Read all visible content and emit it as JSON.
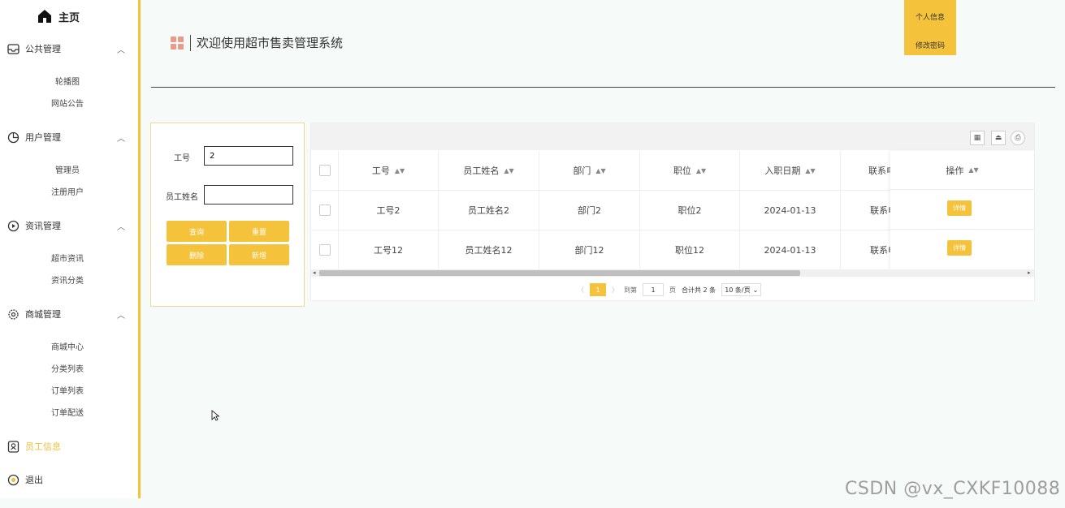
{
  "sidebar": {
    "home": "主页",
    "groups": [
      {
        "label": "公共管理",
        "items": [
          "轮播图",
          "网站公告"
        ]
      },
      {
        "label": "用户管理",
        "items": [
          "管理员",
          "注册用户"
        ]
      },
      {
        "label": "资讯管理",
        "items": [
          "超市资讯",
          "资讯分类"
        ]
      },
      {
        "label": "商城管理",
        "items": [
          "商城中心",
          "分类列表",
          "订单列表",
          "订单配送"
        ]
      }
    ],
    "employee_info": "员工信息",
    "logout": "退出"
  },
  "header": {
    "title": "欢迎使用超市售卖管理系统",
    "profile_button": "个人信息",
    "password_button": "修改密码"
  },
  "search": {
    "id_label": "工号",
    "id_value": "2",
    "name_label": "员工姓名",
    "name_value": "",
    "query_button": "查询",
    "reset_button": "重置",
    "delete_button": "删除",
    "add_button": "新增"
  },
  "table": {
    "columns": [
      "工号",
      "员工姓名",
      "部门",
      "职位",
      "入职日期",
      "联系电话",
      "操作"
    ],
    "rows": [
      {
        "id": "工号2",
        "name": "员工姓名2",
        "dept": "部门2",
        "position": "职位2",
        "date": "2024-01-13",
        "phone": "联系电话"
      },
      {
        "id": "工号12",
        "name": "员工姓名12",
        "dept": "部门12",
        "position": "职位12",
        "date": "2024-01-13",
        "phone": "联系电话"
      }
    ],
    "detail_button": "详情"
  },
  "pagination": {
    "current_page": "1",
    "goto_label": "到第",
    "goto_value": "1",
    "page_label": "页",
    "total": "合计共 2 条",
    "page_size": "10 条/页"
  },
  "watermark": "CSDN @vx_CXKF10088",
  "colors": {
    "accent": "#f5c23b",
    "grid_icon": "#e99b8a"
  }
}
